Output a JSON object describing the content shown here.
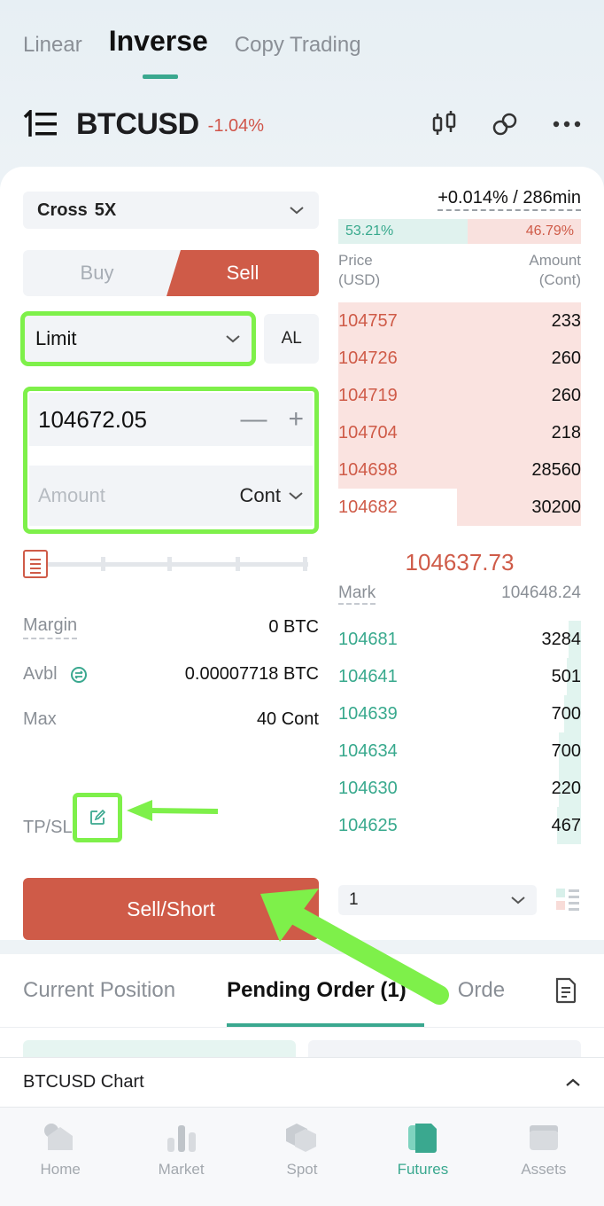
{
  "top_tabs": {
    "linear": "Linear",
    "inverse": "Inverse",
    "copy_trading": "Copy Trading"
  },
  "symbol": {
    "name": "BTCUSD",
    "change": "-1.04%"
  },
  "form": {
    "margin_mode": "Cross",
    "leverage": "5X",
    "buy_label": "Buy",
    "sell_label": "Sell",
    "order_type": "Limit",
    "al_label": "AL",
    "price_value": "104672.05",
    "amount_placeholder": "Amount",
    "amount_unit": "Cont",
    "margin_label": "Margin",
    "margin_value": "0 BTC",
    "avbl_label": "Avbl",
    "avbl_value": "0.00007718 BTC",
    "max_label": "Max",
    "max_value": "40 Cont",
    "tpsl_label": "TP/SL",
    "submit_label": "Sell/Short"
  },
  "orderbook": {
    "funding": "+0.014% / 286min",
    "buy_ratio": "53.21%",
    "sell_ratio": "46.79%",
    "price_header": [
      "Price",
      "(USD)"
    ],
    "amount_header": [
      "Amount",
      "(Cont)"
    ],
    "asks": [
      {
        "price": "104757",
        "qty": "233",
        "depth": 1.0
      },
      {
        "price": "104726",
        "qty": "260",
        "depth": 1.0
      },
      {
        "price": "104719",
        "qty": "260",
        "depth": 1.0
      },
      {
        "price": "104704",
        "qty": "218",
        "depth": 1.0
      },
      {
        "price": "104698",
        "qty": "28560",
        "depth": 1.0
      },
      {
        "price": "104682",
        "qty": "30200",
        "depth": 0.51
      }
    ],
    "last_price": "104637.73",
    "mark_label": "Mark",
    "mark_price": "104648.24",
    "bids": [
      {
        "price": "104681",
        "qty": "3284",
        "depth": 0.05
      },
      {
        "price": "104641",
        "qty": "501",
        "depth": 0.06
      },
      {
        "price": "104639",
        "qty": "700",
        "depth": 0.07
      },
      {
        "price": "104634",
        "qty": "700",
        "depth": 0.09
      },
      {
        "price": "104630",
        "qty": "220",
        "depth": 0.09
      },
      {
        "price": "104625",
        "qty": "467",
        "depth": 0.1
      }
    ],
    "step": "1"
  },
  "bottom_tabs": {
    "current_position": "Current Position",
    "pending_order": "Pending Order (1)",
    "orders": "Orde"
  },
  "chart_bar": {
    "label": "BTCUSD Chart"
  },
  "nav": [
    {
      "label": "Home",
      "icon": "home-icon"
    },
    {
      "label": "Market",
      "icon": "market-icon"
    },
    {
      "label": "Spot",
      "icon": "spot-icon"
    },
    {
      "label": "Futures",
      "icon": "futures-icon"
    },
    {
      "label": "Assets",
      "icon": "wallet-icon"
    }
  ],
  "colors": {
    "accent_green": "#3aa88f",
    "sell_red": "#cf5b48",
    "highlight": "#7ef04a"
  }
}
